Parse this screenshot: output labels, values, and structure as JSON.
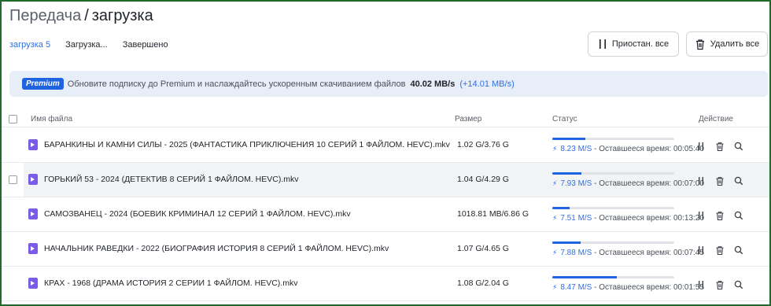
{
  "breadcrumb": {
    "parent": "Передача",
    "separator": "/",
    "current": "загрузка"
  },
  "tabs": [
    {
      "label": "загрузка 5",
      "active": true
    },
    {
      "label": "Загрузка...",
      "active": false
    },
    {
      "label": "Завершено",
      "active": false
    }
  ],
  "toolbar": {
    "pause_all": "Приостан. все",
    "delete_all": "Удалить все"
  },
  "banner": {
    "badge": "Premium",
    "text": "Обновите подписку до Premium и наслаждайтесь ускоренным скачиванием файлов",
    "speed": "40.02 MB/s",
    "bonus": "(+14.01 MB/s)"
  },
  "columns": {
    "name": "Имя файла",
    "size": "Размер",
    "status": "Статус",
    "action": "Действие"
  },
  "status_prefix": "- Оставшееся время:",
  "colors": {
    "accent": "#1f63e0",
    "file_icon": "#7b5ce6"
  },
  "rows": [
    {
      "name": "БАРАНКИНЫ И КАМНИ СИЛЫ - 2025 (ФАНТАСТИКА ПРИКЛЮЧЕНИЯ 10 СЕРИЙ 1 ФАЙЛОМ. HEVC).mkv",
      "size": "1.02 G/3.76 G",
      "progress": 0.27,
      "speed": "8.23 M/S",
      "remaining": "00:05:40",
      "highlighted": false
    },
    {
      "name": "ГОРЬКИЙ 53 - 2024 (ДЕТЕКТИВ 8 СЕРИЙ 1 ФАЙЛОМ. HEVC).mkv",
      "size": "1.04 G/4.29 G",
      "progress": 0.24,
      "speed": "7.93 M/S",
      "remaining": "00:07:00",
      "highlighted": true
    },
    {
      "name": "САМОЗВАНЕЦ - 2024 (БОЕВИК КРИМИНАЛ 12 СЕРИЙ 1 ФАЙЛОМ. HEVC).mkv",
      "size": "1018.81 MB/6.86 G",
      "progress": 0.14,
      "speed": "7.51 M/S",
      "remaining": "00:13:20",
      "highlighted": false
    },
    {
      "name": "НАЧАЛЬНИК РАВЕДКИ - 2022 (БИОГРАФИЯ ИСТОРИЯ 8 СЕРИЙ 1 ФАЙЛОМ. HEVC).mkv",
      "size": "1.07 G/4.65 G",
      "progress": 0.23,
      "speed": "7.88 M/S",
      "remaining": "00:07:45",
      "highlighted": false
    },
    {
      "name": "КРАХ - 1968 (ДРАМА ИСТОРИЯ 2 СЕРИИ 1 ФАЙЛОМ. HEVC).mkv",
      "size": "1.08 G/2.04 G",
      "progress": 0.53,
      "speed": "8.47 M/S",
      "remaining": "00:01:55",
      "highlighted": false
    }
  ]
}
